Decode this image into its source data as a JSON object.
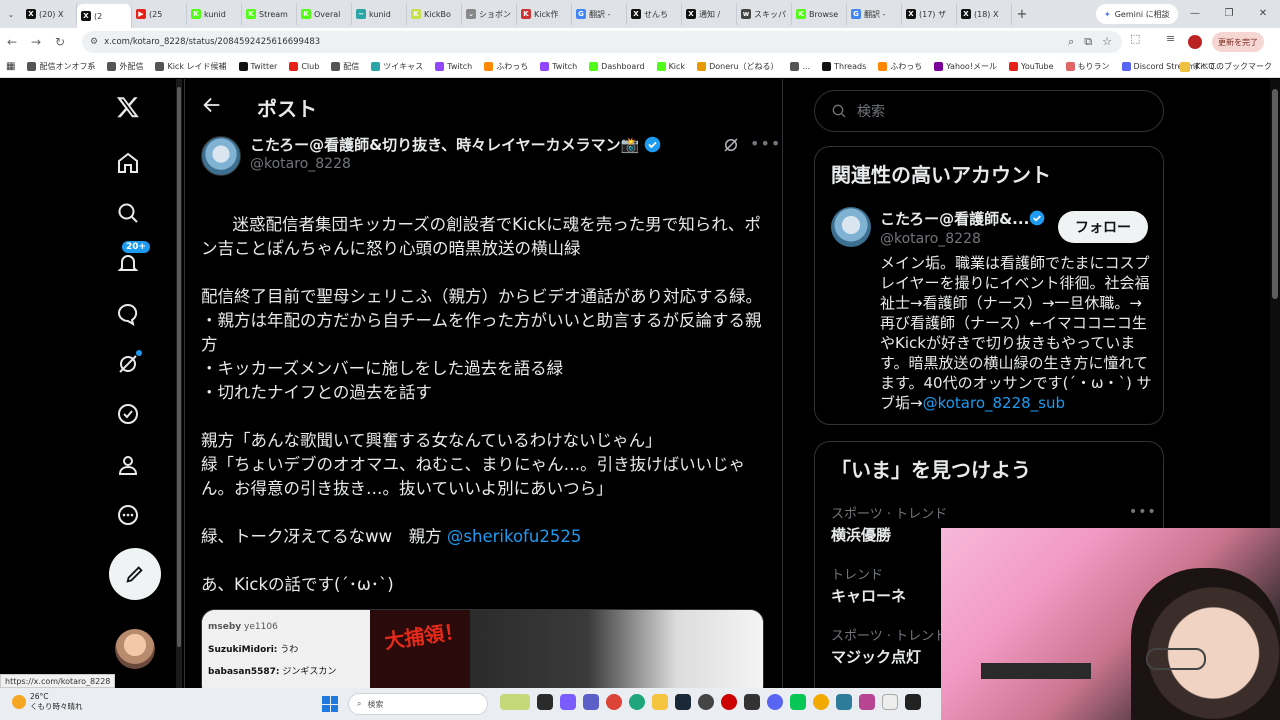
{
  "browser": {
    "tabs": [
      {
        "label": "(20) X",
        "color": "#111111",
        "glyph": "X"
      },
      {
        "label": "(2",
        "color": "#111111",
        "glyph": "X",
        "active": true
      },
      {
        "label": "(25",
        "color": "#e62117",
        "glyph": "▶"
      },
      {
        "label": "kunid",
        "color": "#53fc18",
        "glyph": "K"
      },
      {
        "label": "Stream",
        "color": "#53fc18",
        "glyph": "K"
      },
      {
        "label": "Overal",
        "color": "#53fc18",
        "glyph": "K"
      },
      {
        "label": "kunid",
        "color": "#2aa6a6",
        "glyph": "~"
      },
      {
        "label": "KickBo",
        "color": "#c7e04a",
        "glyph": "K"
      },
      {
        "label": "ショボン",
        "color": "#888888",
        "glyph": "⌄"
      },
      {
        "label": "Kick作",
        "color": "#cc3333",
        "glyph": "K"
      },
      {
        "label": "翻訳 -",
        "color": "#4285f4",
        "glyph": "G"
      },
      {
        "label": "せんち",
        "color": "#111111",
        "glyph": "X"
      },
      {
        "label": "通知 /",
        "color": "#111111",
        "glyph": "X"
      },
      {
        "label": "スキッパ",
        "color": "#444444",
        "glyph": "w"
      },
      {
        "label": "Browse",
        "color": "#53fc18",
        "glyph": "K"
      },
      {
        "label": "翻訳 -",
        "color": "#4285f4",
        "glyph": "G"
      },
      {
        "label": "(17) ザ",
        "color": "#111111",
        "glyph": "X"
      },
      {
        "label": "(18) X",
        "color": "#111111",
        "glyph": "X"
      }
    ],
    "new_tab": "+",
    "gemini_label": "Gemini に相談",
    "url": "x.com/kotaro_8228/status/2084592425616699483",
    "update_label": "更新を完了",
    "bookmarks": [
      {
        "label": "配信オンオフ系",
        "color": "#555555"
      },
      {
        "label": "外配信",
        "color": "#555555"
      },
      {
        "label": "Kick レイド候補",
        "color": "#555555"
      },
      {
        "label": "Twitter",
        "color": "#111111"
      },
      {
        "label": "Club",
        "color": "#e62117"
      },
      {
        "label": "配信",
        "color": "#555555"
      },
      {
        "label": "ツイキャス",
        "color": "#2aa6a6"
      },
      {
        "label": "Twitch",
        "color": "#9146ff"
      },
      {
        "label": "ふわっち",
        "color": "#ff8800"
      },
      {
        "label": "Twitch",
        "color": "#9146ff"
      },
      {
        "label": "Dashboard",
        "color": "#53fc18"
      },
      {
        "label": "Kick",
        "color": "#53fc18"
      },
      {
        "label": "Doneru（どねる）",
        "color": "#e69a00"
      },
      {
        "label": "...",
        "color": "#555555"
      },
      {
        "label": "Threads",
        "color": "#111111"
      },
      {
        "label": "ふわっち",
        "color": "#ff8800"
      },
      {
        "label": "Yahoo!メール",
        "color": "#7b0099"
      },
      {
        "label": "YouTube",
        "color": "#e62117"
      },
      {
        "label": "もりラン",
        "color": "#e06666"
      },
      {
        "label": "Discord StreamKit O...",
        "color": "#5865f2"
      }
    ],
    "all_bookmarks": "すべてのブックマーク",
    "status_url": "https://x.com/kotaro_8228"
  },
  "nav": {
    "notification_badge": "20+"
  },
  "post": {
    "header_title": "ポスト",
    "author_name": "こたろー@看護師&切り抜き、時々レイヤーカメラマン📸",
    "author_handle": "@kotaro_8228",
    "body_lines": [
      "迷惑配信者集団キッカーズの創設者でKickに魂を売った男で知られ、ポン吉ことぽんちゃんに怒り心頭の暗黒放送の横山緑",
      "",
      "配信終了目前で聖母シェリこふ（親方）からビデオ通話があり対応する緑。",
      "・親方は年配の方だから自チームを作った方がいいと助言するが反論する親方",
      "・キッカーズメンバーに施しをした過去を語る緑",
      "・切れたナイフとの過去を話す",
      "",
      "親方「あんな歌聞いて興奮する女なんているわけないじゃん」",
      "緑「ちょいデブのオオマユ、ねむこ、まりにゃん…。引き抜けばいいじゃん。お得意の引き抜き…。抜いていいよ別にあいつら」",
      "",
      "緑、トーク冴えてるなww　親方 "
    ],
    "mention": "@sherikofu2525",
    "last_line": "あ、Kickの話です(´･ω･`)",
    "media": {
      "chat": [
        {
          "user": "mseby",
          "text": "ye1106"
        },
        {
          "user": "SuzukiMidori:",
          "text": "うわ"
        },
        {
          "user": "babasan5587:",
          "text": "ジンギスカン"
        }
      ],
      "banner_text": "大捕領！"
    }
  },
  "sidebar": {
    "search_placeholder": "検索",
    "related_title": "関連性の高いアカウント",
    "related": {
      "name": "こたろー@看護師&...",
      "handle": "@kotaro_8228",
      "follow_label": "フォロー",
      "bio": "メイン垢。職業は看護師でたまにコスプレイヤーを撮りにイベント徘徊。社会福祉士→看護師（ナース）→一旦休職。→再び看護師（ナース）←イマココニコ生やKickが好きで切り抜きもやっています。暗黒放送の横山緑の生き方に憧れてます。40代のオッサンです(´・ω・`) サブ垢→",
      "bio_mention": "@kotaro_8228_sub"
    },
    "trends_title": "「いま」を見つけよう",
    "trends": [
      {
        "meta": "スポーツ · トレンド",
        "name": "横浜優勝"
      },
      {
        "meta": "トレンド",
        "name": "キャローネ"
      },
      {
        "meta": "スポーツ · トレンド",
        "name": "マジック点灯"
      }
    ]
  },
  "taskbar": {
    "temperature": "26°C",
    "weather": "くもり時々晴れ",
    "search_placeholder": "検索"
  },
  "colors": {
    "accent": "#1d9bf0",
    "background": "#000000",
    "text": "#e7e9ea",
    "muted": "#71767b",
    "border": "#2f3336"
  }
}
